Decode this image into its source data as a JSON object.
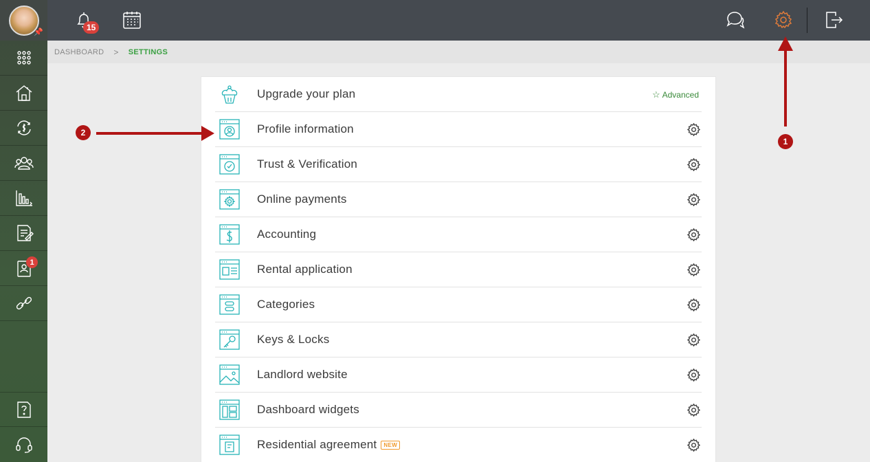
{
  "sidebar": {
    "avatar_alt": "user-avatar",
    "items": [
      {
        "name": "apps-grid-icon"
      },
      {
        "name": "properties-icon"
      },
      {
        "name": "payments-icon"
      },
      {
        "name": "tenants-icon"
      },
      {
        "name": "reports-icon"
      },
      {
        "name": "leases-icon"
      },
      {
        "name": "applicants-icon",
        "badge": "1"
      },
      {
        "name": "links-icon"
      }
    ],
    "bottom": [
      {
        "name": "help-icon"
      },
      {
        "name": "support-icon"
      }
    ]
  },
  "topbar": {
    "notifications_count": "15",
    "icons": [
      "bell-icon",
      "calendar-icon",
      "chat-icon",
      "gear-icon",
      "logout-icon"
    ]
  },
  "breadcrumb": {
    "root": "DASHBOARD",
    "separator": ">",
    "current": "SETTINGS"
  },
  "settings": {
    "plan_label": "Advanced",
    "items": [
      {
        "label": "Upgrade your plan",
        "icon": "cupcake-icon"
      },
      {
        "label": "Profile information",
        "icon": "profile-icon"
      },
      {
        "label": "Trust & Verification",
        "icon": "verification-icon"
      },
      {
        "label": "Online payments",
        "icon": "payments-settings-icon"
      },
      {
        "label": "Accounting",
        "icon": "dollar-icon"
      },
      {
        "label": "Rental application",
        "icon": "application-icon"
      },
      {
        "label": "Categories",
        "icon": "categories-icon"
      },
      {
        "label": "Keys & Locks",
        "icon": "key-icon"
      },
      {
        "label": "Landlord website",
        "icon": "website-icon"
      },
      {
        "label": "Dashboard widgets",
        "icon": "widgets-icon"
      },
      {
        "label": "Residential agreement",
        "icon": "agreement-icon",
        "tag": "NEW"
      }
    ]
  },
  "annotations": {
    "step1": "1",
    "step2": "2",
    "color": "#b01515"
  },
  "colors": {
    "accent_green": "#3aa042",
    "icon_teal": "#26b3b7",
    "topbar": "#454a50",
    "badge_red": "#d9413b",
    "highlight_orange": "#e07b3a"
  }
}
